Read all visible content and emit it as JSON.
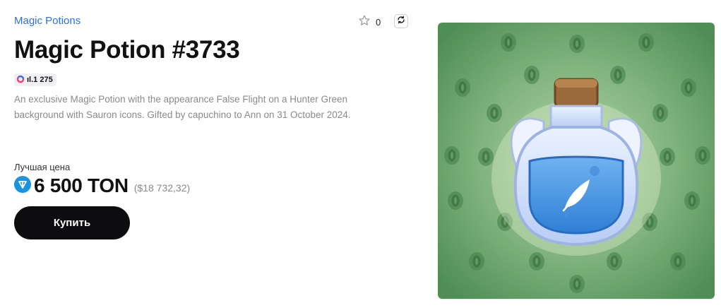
{
  "collection": {
    "name": "Magic Potions"
  },
  "favorites": {
    "count": "0",
    "icon": "star-outline-icon"
  },
  "refresh": {
    "icon": "refresh-icon"
  },
  "nft": {
    "title": "Magic Potion #3733",
    "stats": "ıl.1 275",
    "description": "An exclusive Magic Potion with the appearance False Flight on a Hunter Green background with Sauron icons. Gifted by capuchino to Ann on 31 October 2024."
  },
  "price": {
    "label": "Лучшая цена",
    "value": "6 500 TON",
    "usd": "($18 732,32)",
    "currency_icon": "ton-icon"
  },
  "actions": {
    "buy_label": "Купить"
  },
  "artwork": {
    "background_color": "#5a9a5f",
    "pattern_icon": "sauron-eye-icon",
    "item_icon": "potion-bottle-icon",
    "symbol_icon": "feather-icon"
  },
  "colors": {
    "link": "#2f6fe4",
    "ton": "#1a93e0",
    "button": "#0d0d0f"
  }
}
